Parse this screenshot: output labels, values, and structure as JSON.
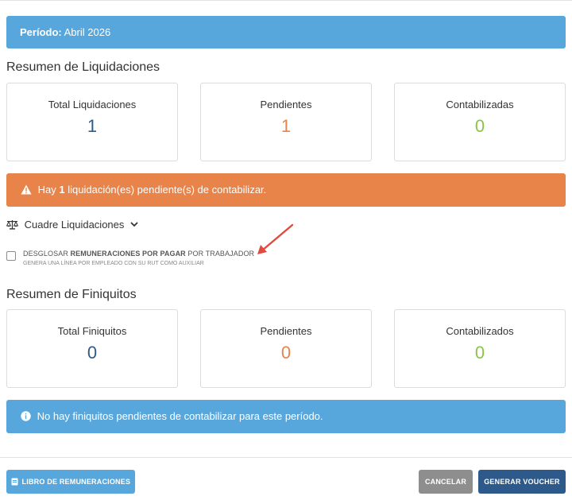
{
  "period": {
    "label": "Período:",
    "value": "Abril 2026"
  },
  "liquidaciones": {
    "title": "Resumen de Liquidaciones",
    "cards": [
      {
        "label": "Total Liquidaciones",
        "value": "1"
      },
      {
        "label": "Pendientes",
        "value": "1"
      },
      {
        "label": "Contabilizadas",
        "value": "0"
      }
    ],
    "alert": {
      "prefix": "Hay",
      "count": "1",
      "suffix": "liquidación(es) pendiente(s) de contabilizar."
    },
    "cuadre_toggle": "Cuadre Liquidaciones"
  },
  "desglose": {
    "title_part1": "DESGLOSAR",
    "title_bold": "REMUNERACIONES POR PAGAR",
    "title_part2": "POR TRABAJADOR",
    "subtitle": "GENERA UNA LÍNEA POR EMPLEADO CON SU RUT COMO AUXILIAR",
    "checked": false
  },
  "finiquitos": {
    "title": "Resumen de Finiquitos",
    "cards": [
      {
        "label": "Total Finiquitos",
        "value": "0"
      },
      {
        "label": "Pendientes",
        "value": "0"
      },
      {
        "label": "Contabilizados",
        "value": "0"
      }
    ],
    "alert": "No hay finiquitos pendientes de contabilizar para este período."
  },
  "footer": {
    "libro_button": "LIBRO DE REMUNERACIONES",
    "cancel_button": "CANCELAR",
    "generate_button": "GENERAR VOUCHER"
  },
  "colors": {
    "info_blue": "#58a7dc",
    "warning_orange": "#e8834a",
    "value_blue": "#2f5b84",
    "value_orange": "#e8834c",
    "value_green": "#8bc34a",
    "primary_dark": "#2d5a8a",
    "cancel_gray": "#8e8e8e",
    "arrow_red": "#e04a3f"
  },
  "icons": {
    "warning": "warning-triangle-icon",
    "info": "info-circle-icon",
    "balance": "balance-scale-icon",
    "chevron": "chevron-down-icon",
    "book": "book-icon",
    "annotation": "red-arrow-annotation"
  }
}
